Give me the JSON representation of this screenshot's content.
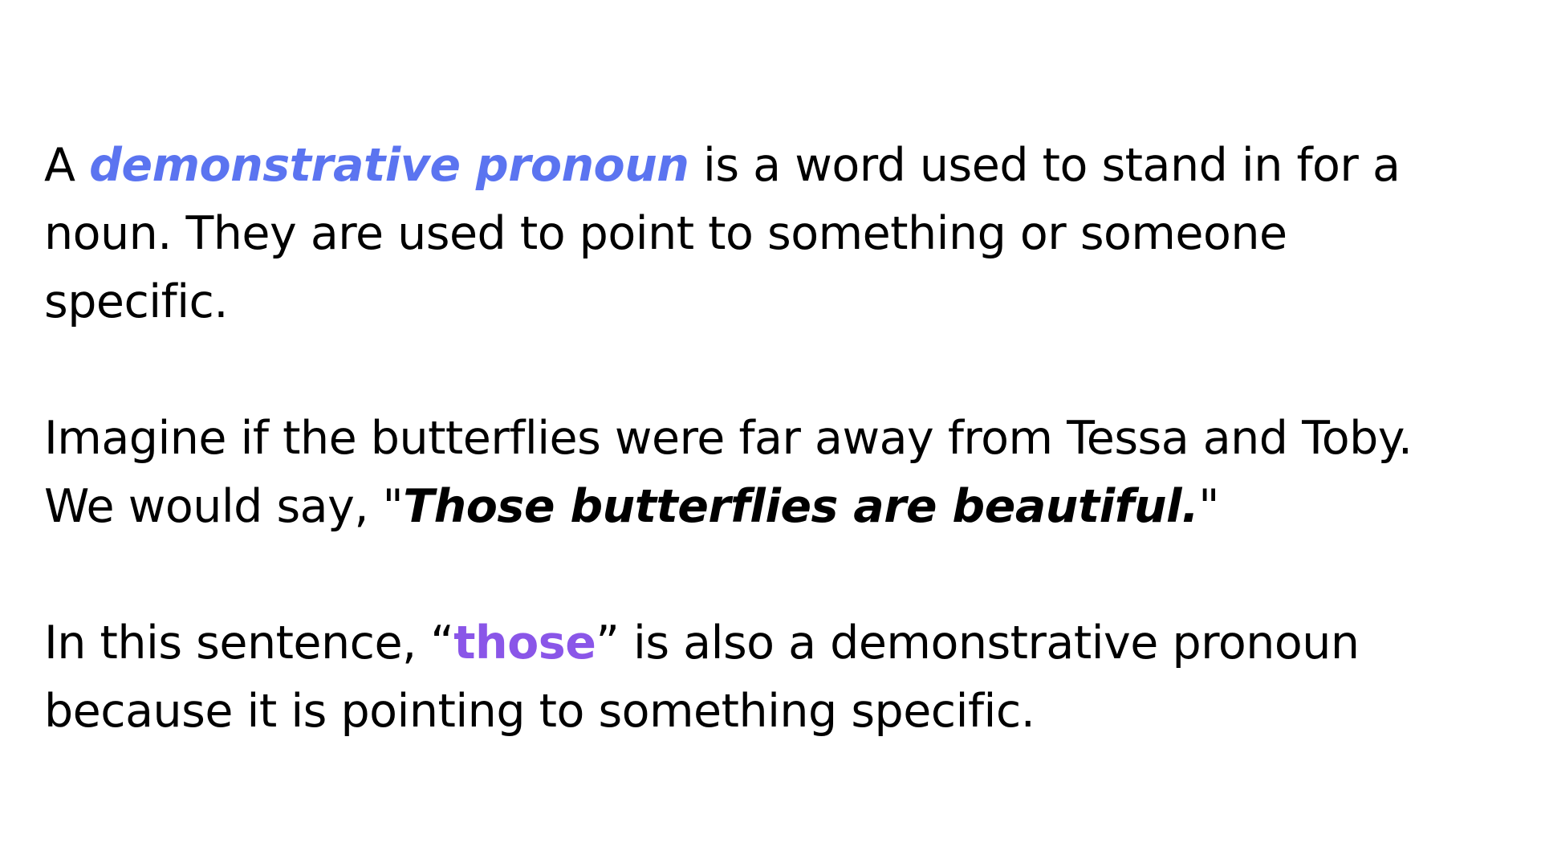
{
  "colors": {
    "term": "#5b74f0",
    "highlight": "#8a56e8",
    "text": "#000000",
    "background": "#ffffff"
  },
  "paragraph1": {
    "prefix": "A ",
    "term": "demonstrative pronoun",
    "line1_rest": " is a word used to stand in for a",
    "line2": "noun. They are used to point to something or someone",
    "line3": "specific."
  },
  "paragraph2": {
    "line1": "Imagine if the butterflies were far away from Tessa and Toby.",
    "line2_prefix": "We would say, \"",
    "example": "Those butterflies are beautiful.",
    "line2_suffix": "\""
  },
  "paragraph3": {
    "line1_prefix": "In this sentence, “",
    "highlight": "those",
    "line1_suffix": "” is also a demonstrative pronoun",
    "line2": "because it is pointing to something specific."
  }
}
